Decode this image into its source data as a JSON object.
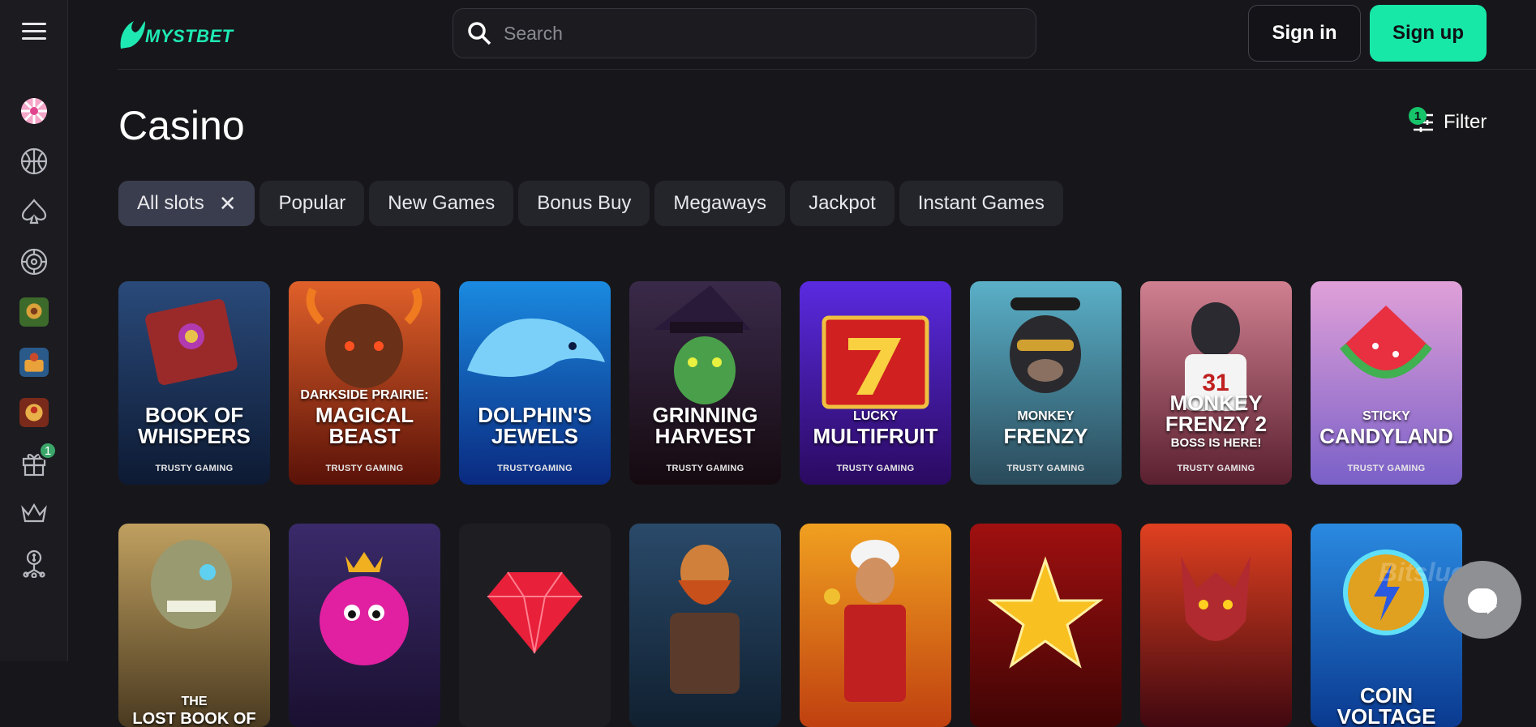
{
  "brand": {
    "name": "MYSTBET",
    "accent": "#17e8a8"
  },
  "search": {
    "placeholder": "Search"
  },
  "auth": {
    "signin_label": "Sign in",
    "signup_label": "Sign up"
  },
  "sidebar": {
    "menu_icon": "menu-icon",
    "items": [
      {
        "icon": "candy-icon"
      },
      {
        "icon": "basketball-icon"
      },
      {
        "icon": "spade-icon"
      },
      {
        "icon": "roulette-icon"
      },
      {
        "icon": "game-thumb-1"
      },
      {
        "icon": "game-thumb-2"
      },
      {
        "icon": "game-thumb-3"
      },
      {
        "icon": "gift-icon",
        "badge": "1"
      },
      {
        "icon": "crown-icon"
      },
      {
        "icon": "affiliate-icon"
      }
    ]
  },
  "page": {
    "title": "Casino"
  },
  "filter": {
    "label": "Filter",
    "badge": "1"
  },
  "categories": [
    {
      "label": "All slots",
      "active": true
    },
    {
      "label": "Popular"
    },
    {
      "label": "New Games"
    },
    {
      "label": "Bonus Buy"
    },
    {
      "label": "Megaways"
    },
    {
      "label": "Jackpot"
    },
    {
      "label": "Instant Games"
    }
  ],
  "games": [
    {
      "pre": "",
      "title": "BOOK OF WHISPERS",
      "post": "",
      "provider": "TRUSTY GAMING"
    },
    {
      "pre": "DARKSIDE PRAIRIE:",
      "title": "MAGICAL BEAST",
      "post": "",
      "provider": "TRUSTY GAMING"
    },
    {
      "pre": "",
      "title": "DOLPHIN'S JEWELS",
      "post": "",
      "provider": "TRUSTYGAMING"
    },
    {
      "pre": "",
      "title": "GRINNING HARVEST",
      "post": "",
      "provider": "TRUSTY GAMING"
    },
    {
      "pre": "LUCKY",
      "title": "MULTIFRUIT",
      "post": "",
      "provider": "TRUSTY GAMING"
    },
    {
      "pre": "MONKEY",
      "title": "FRENZY",
      "post": "",
      "provider": "TRUSTY GAMING"
    },
    {
      "pre": "",
      "title": "MONKEY FRENZY 2",
      "post": "BOSS IS HERE!",
      "provider": "TRUSTY GAMING"
    },
    {
      "pre": "STICKY",
      "title": "CANDYLAND",
      "post": "",
      "provider": "TRUSTY GAMING"
    },
    {
      "pre": "THE",
      "title": "LOST BOOK OF",
      "post": "",
      "provider": ""
    },
    {
      "pre": "",
      "title": "",
      "post": "",
      "provider": ""
    },
    {
      "pre": "",
      "title": "",
      "post": "",
      "provider": ""
    },
    {
      "pre": "",
      "title": "",
      "post": "",
      "provider": ""
    },
    {
      "pre": "",
      "title": "",
      "post": "",
      "provider": ""
    },
    {
      "pre": "",
      "title": "",
      "post": "",
      "provider": ""
    },
    {
      "pre": "",
      "title": "",
      "post": "",
      "provider": ""
    },
    {
      "pre": "",
      "title": "COIN VOLTAGE",
      "post": "",
      "provider": ""
    }
  ],
  "chat": {
    "icon": "chat-icon"
  },
  "watermark": "Bitsluck"
}
